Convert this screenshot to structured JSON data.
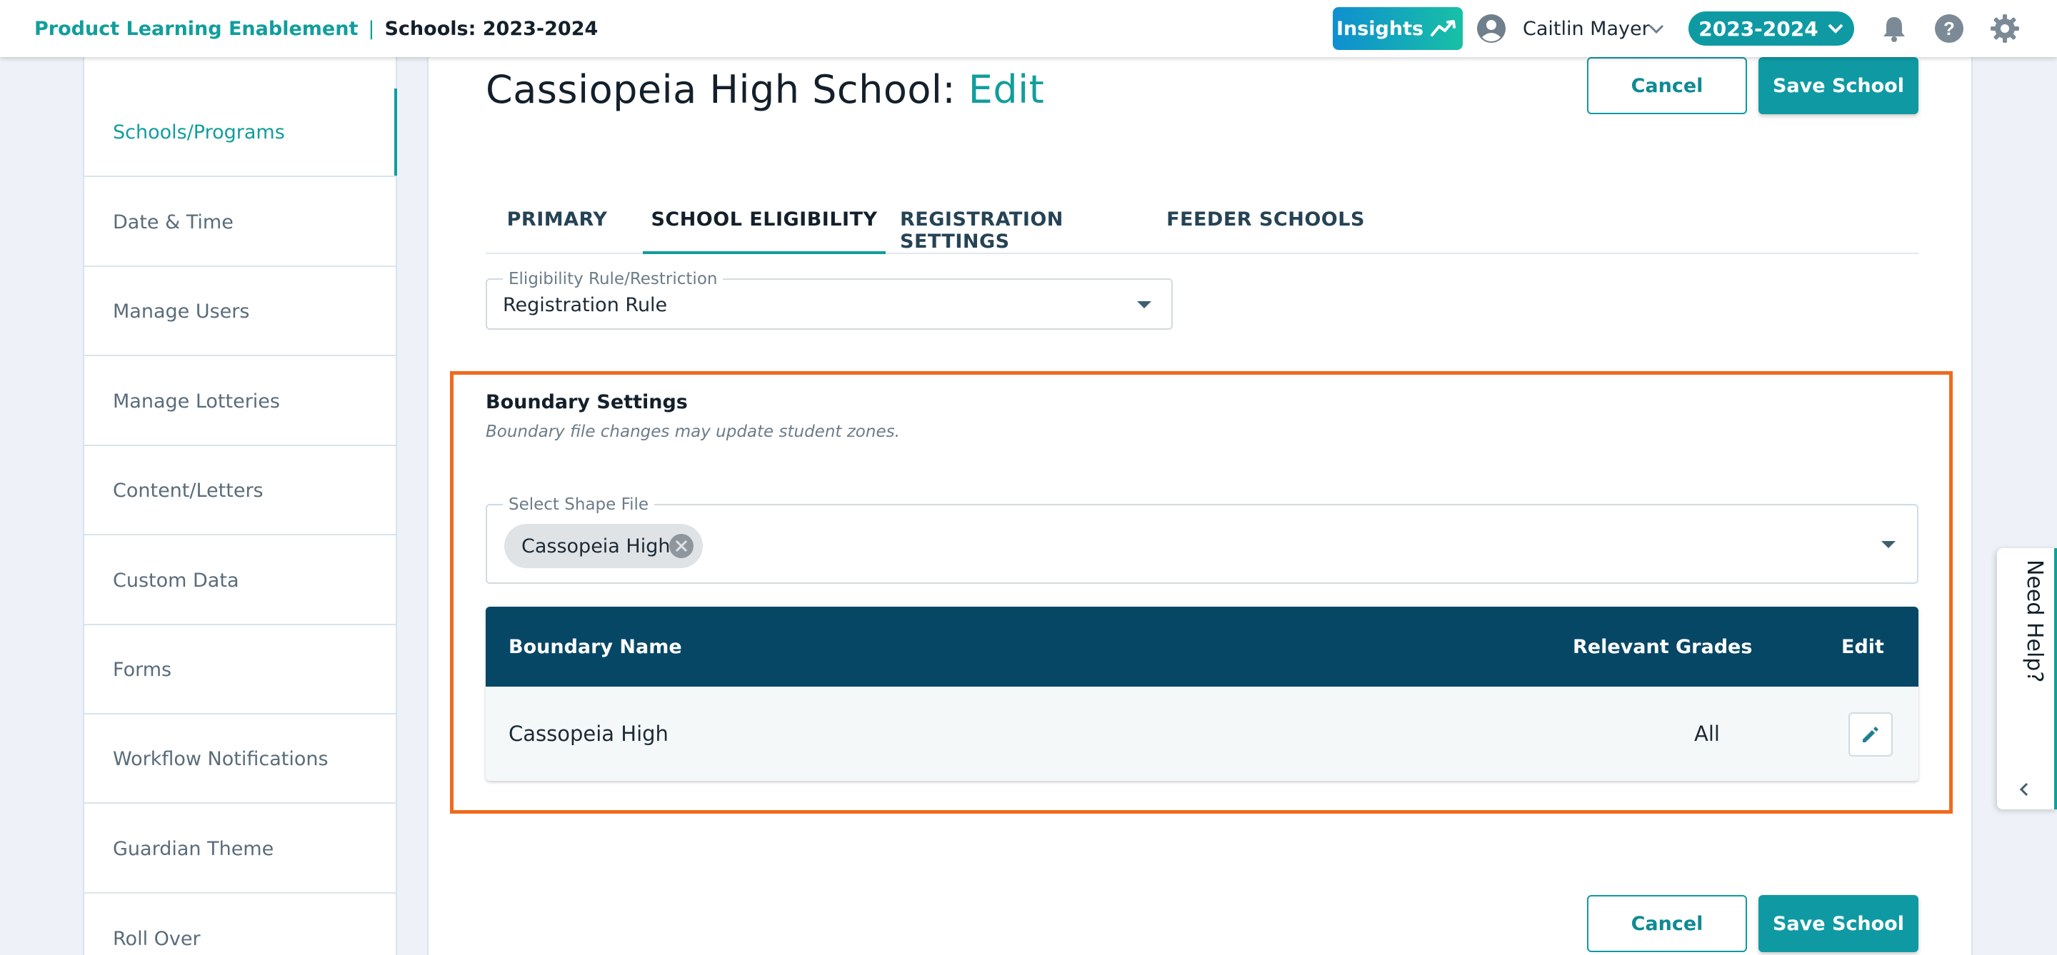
{
  "header": {
    "org_name": "Product Learning Enablement",
    "separator": "|",
    "page_name": "Schools: 2023-2024",
    "insights_label": "Insights",
    "user_name": "Caitlin Mayer",
    "year_label": "2023-2024"
  },
  "sidebar": {
    "items": [
      {
        "label": "Schools/Programs",
        "active": true
      },
      {
        "label": "Date & Time"
      },
      {
        "label": "Manage Users"
      },
      {
        "label": "Manage Lotteries"
      },
      {
        "label": "Content/Letters"
      },
      {
        "label": "Custom Data"
      },
      {
        "label": "Forms"
      },
      {
        "label": "Workflow Notifications"
      },
      {
        "label": "Guardian Theme"
      },
      {
        "label": "Roll Over"
      }
    ]
  },
  "main": {
    "title": "Cassiopeia High School:",
    "title_accent": "Edit",
    "cancel_label": "Cancel",
    "save_label": "Save School",
    "tabs": [
      {
        "label": "PRIMARY"
      },
      {
        "label": "SCHOOL ELIGIBILITY",
        "active": true
      },
      {
        "label": "REGISTRATION SETTINGS"
      },
      {
        "label": "FEEDER SCHOOLS"
      }
    ],
    "eligibility": {
      "label": "Eligibility Rule/Restriction",
      "value": "Registration Rule"
    },
    "boundary": {
      "title": "Boundary Settings",
      "subtitle": "Boundary file changes may update student zones.",
      "shape_label": "Select Shape File",
      "shape_chip": "Cassopeia High",
      "columns": [
        "Boundary Name",
        "Relevant Grades",
        "Edit"
      ],
      "rows": [
        {
          "name": "Cassopeia High",
          "grades": "All"
        }
      ]
    }
  },
  "help": {
    "label": "Need Help?"
  },
  "colors": {
    "accent": "#119e9c",
    "table_header": "#064766",
    "highlight": "#f06a1e"
  }
}
